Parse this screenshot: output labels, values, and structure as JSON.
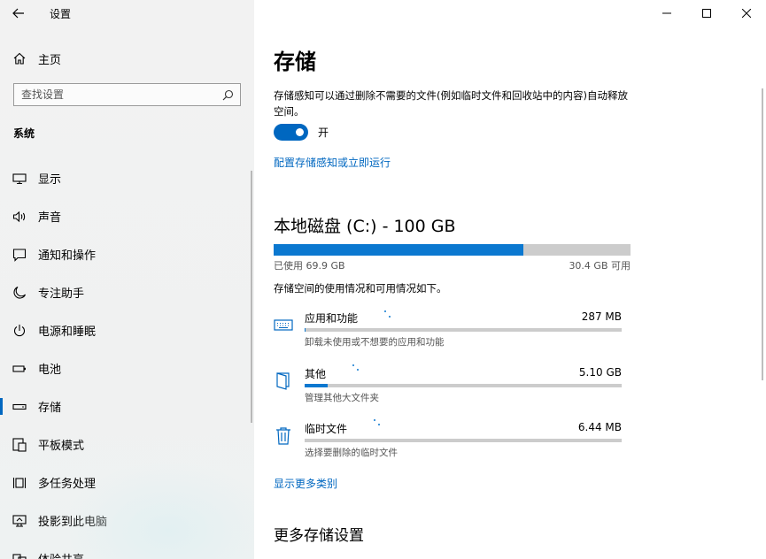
{
  "window": {
    "title": "设置",
    "controls": [
      "minimize",
      "maximize",
      "close"
    ]
  },
  "sidebar": {
    "home_label": "主页",
    "search_placeholder": "查找设置",
    "section_title": "系统",
    "items": [
      {
        "label": "显示",
        "icon": "display-icon"
      },
      {
        "label": "声音",
        "icon": "speaker-icon"
      },
      {
        "label": "通知和操作",
        "icon": "notification-icon"
      },
      {
        "label": "专注助手",
        "icon": "moon-icon"
      },
      {
        "label": "电源和睡眠",
        "icon": "power-icon"
      },
      {
        "label": "电池",
        "icon": "battery-icon"
      },
      {
        "label": "存储",
        "icon": "storage-icon",
        "active": true
      },
      {
        "label": "平板模式",
        "icon": "tablet-icon"
      },
      {
        "label": "多任务处理",
        "icon": "multitask-icon"
      },
      {
        "label": "投影到此电脑",
        "icon": "project-icon"
      },
      {
        "label": "体验共享",
        "icon": "share-icon"
      }
    ]
  },
  "main": {
    "title": "存储",
    "storage_sense_desc": "存储感知可以通过删除不需要的文件(例如临时文件和回收站中的内容)自动释放空间。",
    "toggle_state": "开",
    "toggle_on": true,
    "config_link": "配置存储感知或立即运行",
    "disk": {
      "title": "本地磁盘 (C:) - 100 GB",
      "used_label": "已使用 69.9 GB",
      "free_label": "30.4 GB 可用",
      "used_fraction": 0.699
    },
    "usage_desc": "存储空间的使用情况和可用情况如下。",
    "categories": [
      {
        "name": "应用和功能",
        "size": "287 MB",
        "sub": "卸载未使用或不想要的应用和功能",
        "fraction": 0.004,
        "icon": "keyboard-icon"
      },
      {
        "name": "其他",
        "size": "5.10 GB",
        "sub": "管理其他大文件夹",
        "fraction": 0.073,
        "icon": "folder-icon"
      },
      {
        "name": "临时文件",
        "size": "6.44 MB",
        "sub": "选择要删除的临时文件",
        "fraction": 0.0,
        "icon": "trash-icon"
      }
    ],
    "more_link": "显示更多类别",
    "more_title": "更多存储设置"
  },
  "colors": {
    "accent": "#0067c0",
    "bar_fill": "#0b78d0",
    "bar_track": "#cccccc",
    "sidebar_bg": "#f2f2f2"
  }
}
